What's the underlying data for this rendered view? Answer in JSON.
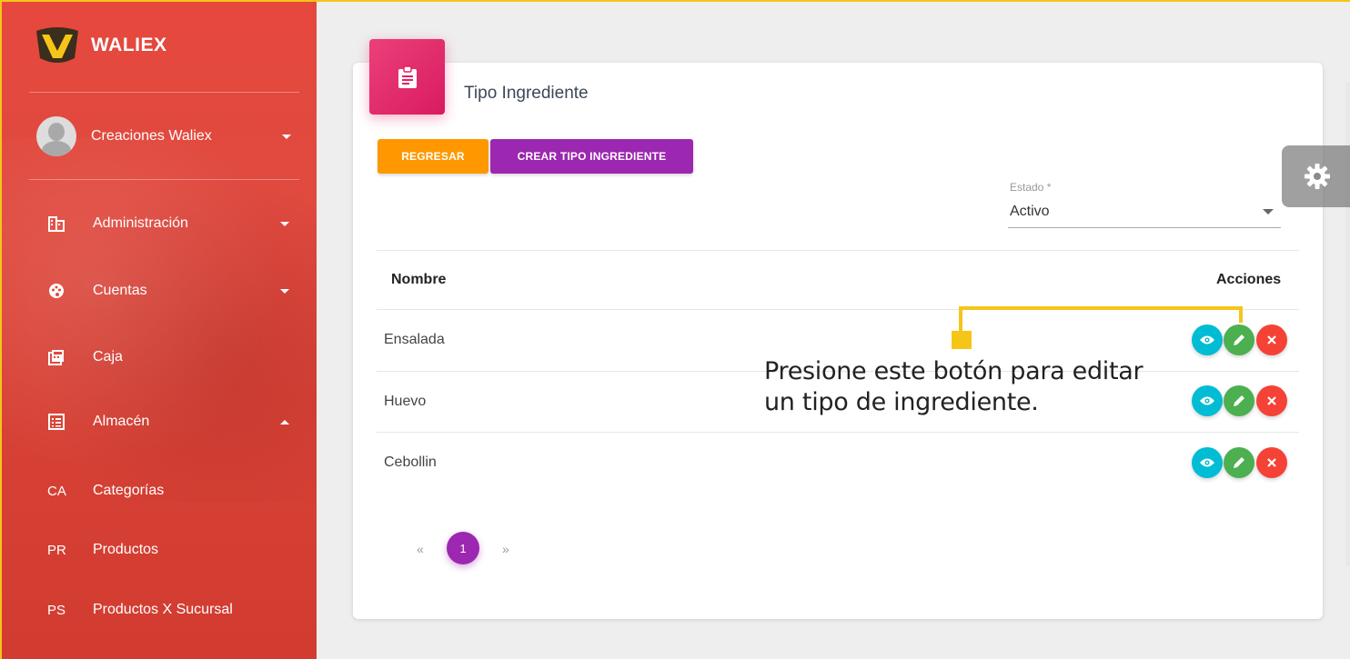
{
  "sidebar": {
    "brand": "WALIEX",
    "user": "Creaciones Waliex",
    "items": [
      {
        "label": "Administración",
        "icon": "building-icon",
        "expand": "down"
      },
      {
        "label": "Cuentas",
        "icon": "palette-icon",
        "expand": "down"
      },
      {
        "label": "Caja",
        "icon": "calculator-icon",
        "expand": ""
      },
      {
        "label": "Almacén",
        "icon": "list-icon",
        "expand": "up"
      }
    ],
    "subitems": [
      {
        "abbr": "CA",
        "label": "Categorías"
      },
      {
        "abbr": "PR",
        "label": "Productos"
      },
      {
        "abbr": "PS",
        "label": "Productos X Sucursal"
      }
    ]
  },
  "card": {
    "title": "Tipo Ingrediente",
    "buttons": {
      "back": "REGRESAR",
      "create": "CREAR TIPO INGREDIENTE"
    },
    "filter": {
      "label": "Estado *",
      "value": "Activo"
    },
    "table": {
      "columns": [
        "Nombre",
        "Acciones"
      ],
      "rows": [
        {
          "nombre": "Ensalada"
        },
        {
          "nombre": "Huevo"
        },
        {
          "nombre": "Cebollin"
        }
      ]
    },
    "pagination": {
      "prev": "«",
      "current": "1",
      "next": "»"
    }
  },
  "annotation": {
    "line1": "Presione este botón para editar",
    "line2": "un tipo de ingrediente."
  },
  "colors": {
    "sidebar": "#e04a3f",
    "orange": "#ff9800",
    "purple": "#9c27b0",
    "pink": "#e91e63",
    "view": "#00bcd4",
    "edit": "#4caf50",
    "delete": "#f44336",
    "callout": "#f5c518"
  }
}
